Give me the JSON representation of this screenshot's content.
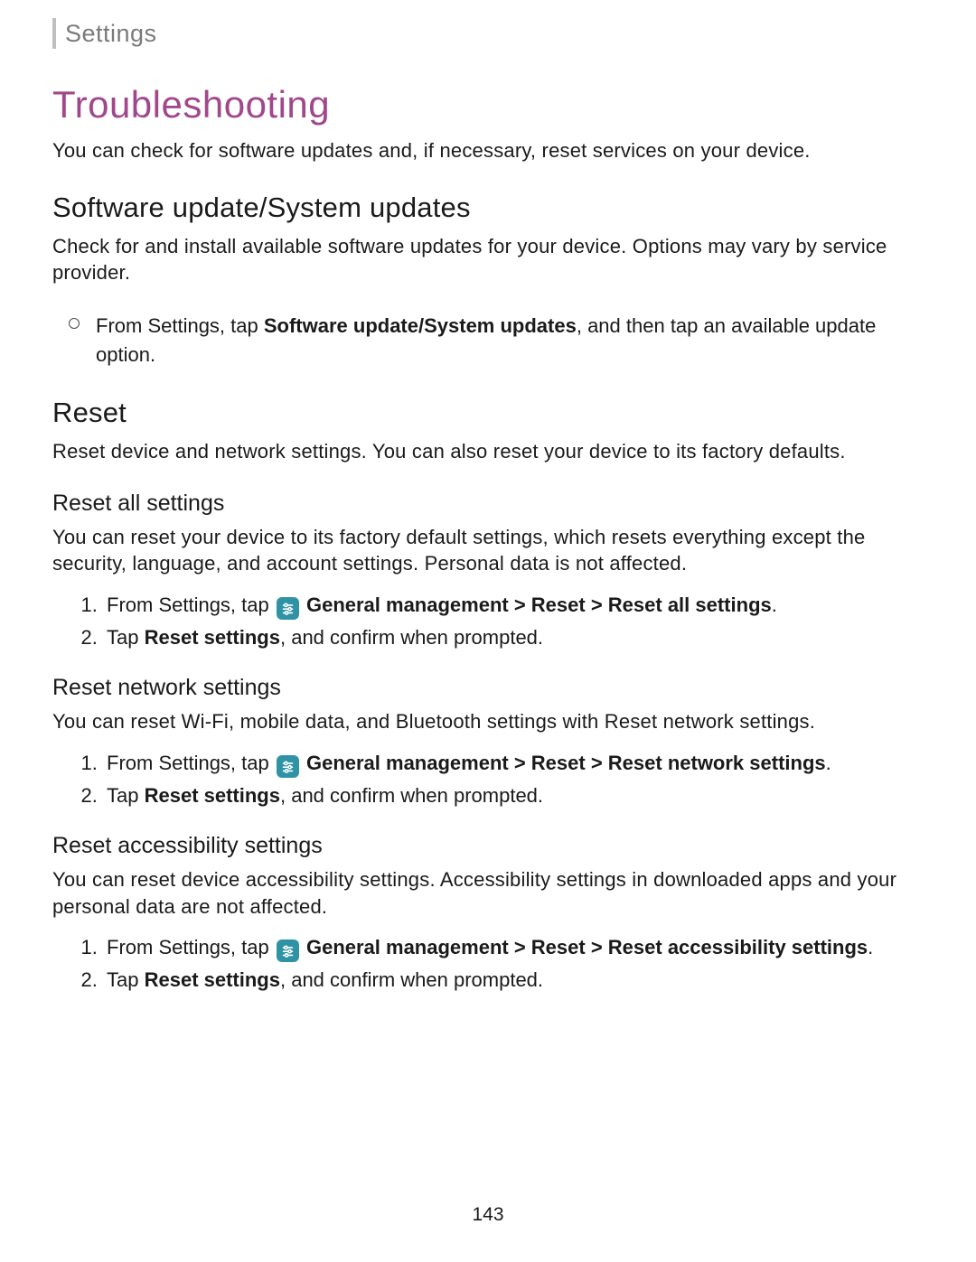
{
  "breadcrumb": "Settings",
  "title": "Troubleshooting",
  "intro": "You can check for software updates and, if necessary, reset services on your device.",
  "section1": {
    "heading": "Software update/System updates",
    "body": "Check for and install available software updates for your device. Options may vary by service provider.",
    "step_prefix": "From Settings, tap ",
    "step_bold": "Software update/System updates",
    "step_suffix": ", and then tap an available update option."
  },
  "section2": {
    "heading": "Reset",
    "body": "Reset device and network settings. You can also reset your device to its factory defaults."
  },
  "ras": {
    "heading": "Reset all settings",
    "body": "You can reset your device to its factory default settings, which resets everything except the security, language, and account settings. Personal data is not affected.",
    "s1_prefix": "From Settings, tap ",
    "s1_bold": " General management > Reset > Reset all settings",
    "s1_suffix": ".",
    "s2_prefix": "Tap ",
    "s2_bold": "Reset settings",
    "s2_suffix": ", and confirm when prompted."
  },
  "rns": {
    "heading": "Reset network settings",
    "body": "You can reset Wi-Fi, mobile data, and Bluetooth settings with Reset network settings.",
    "s1_prefix": "From Settings, tap ",
    "s1_bold": " General management > Reset > Reset network settings",
    "s1_suffix": ".",
    "s2_prefix": "Tap ",
    "s2_bold": "Reset settings",
    "s2_suffix": ", and confirm when prompted."
  },
  "racc": {
    "heading": "Reset accessibility settings",
    "body": "You can reset device accessibility settings. Accessibility settings in downloaded apps and your personal data are not affected.",
    "s1_prefix": "From Settings, tap ",
    "s1_bold": " General management > Reset > Reset accessibility settings",
    "s1_suffix": ".",
    "s2_prefix": "Tap ",
    "s2_bold": "Reset settings",
    "s2_suffix": ", and confirm when prompted."
  },
  "page_number": "143",
  "icon_name": "general-management-icon"
}
